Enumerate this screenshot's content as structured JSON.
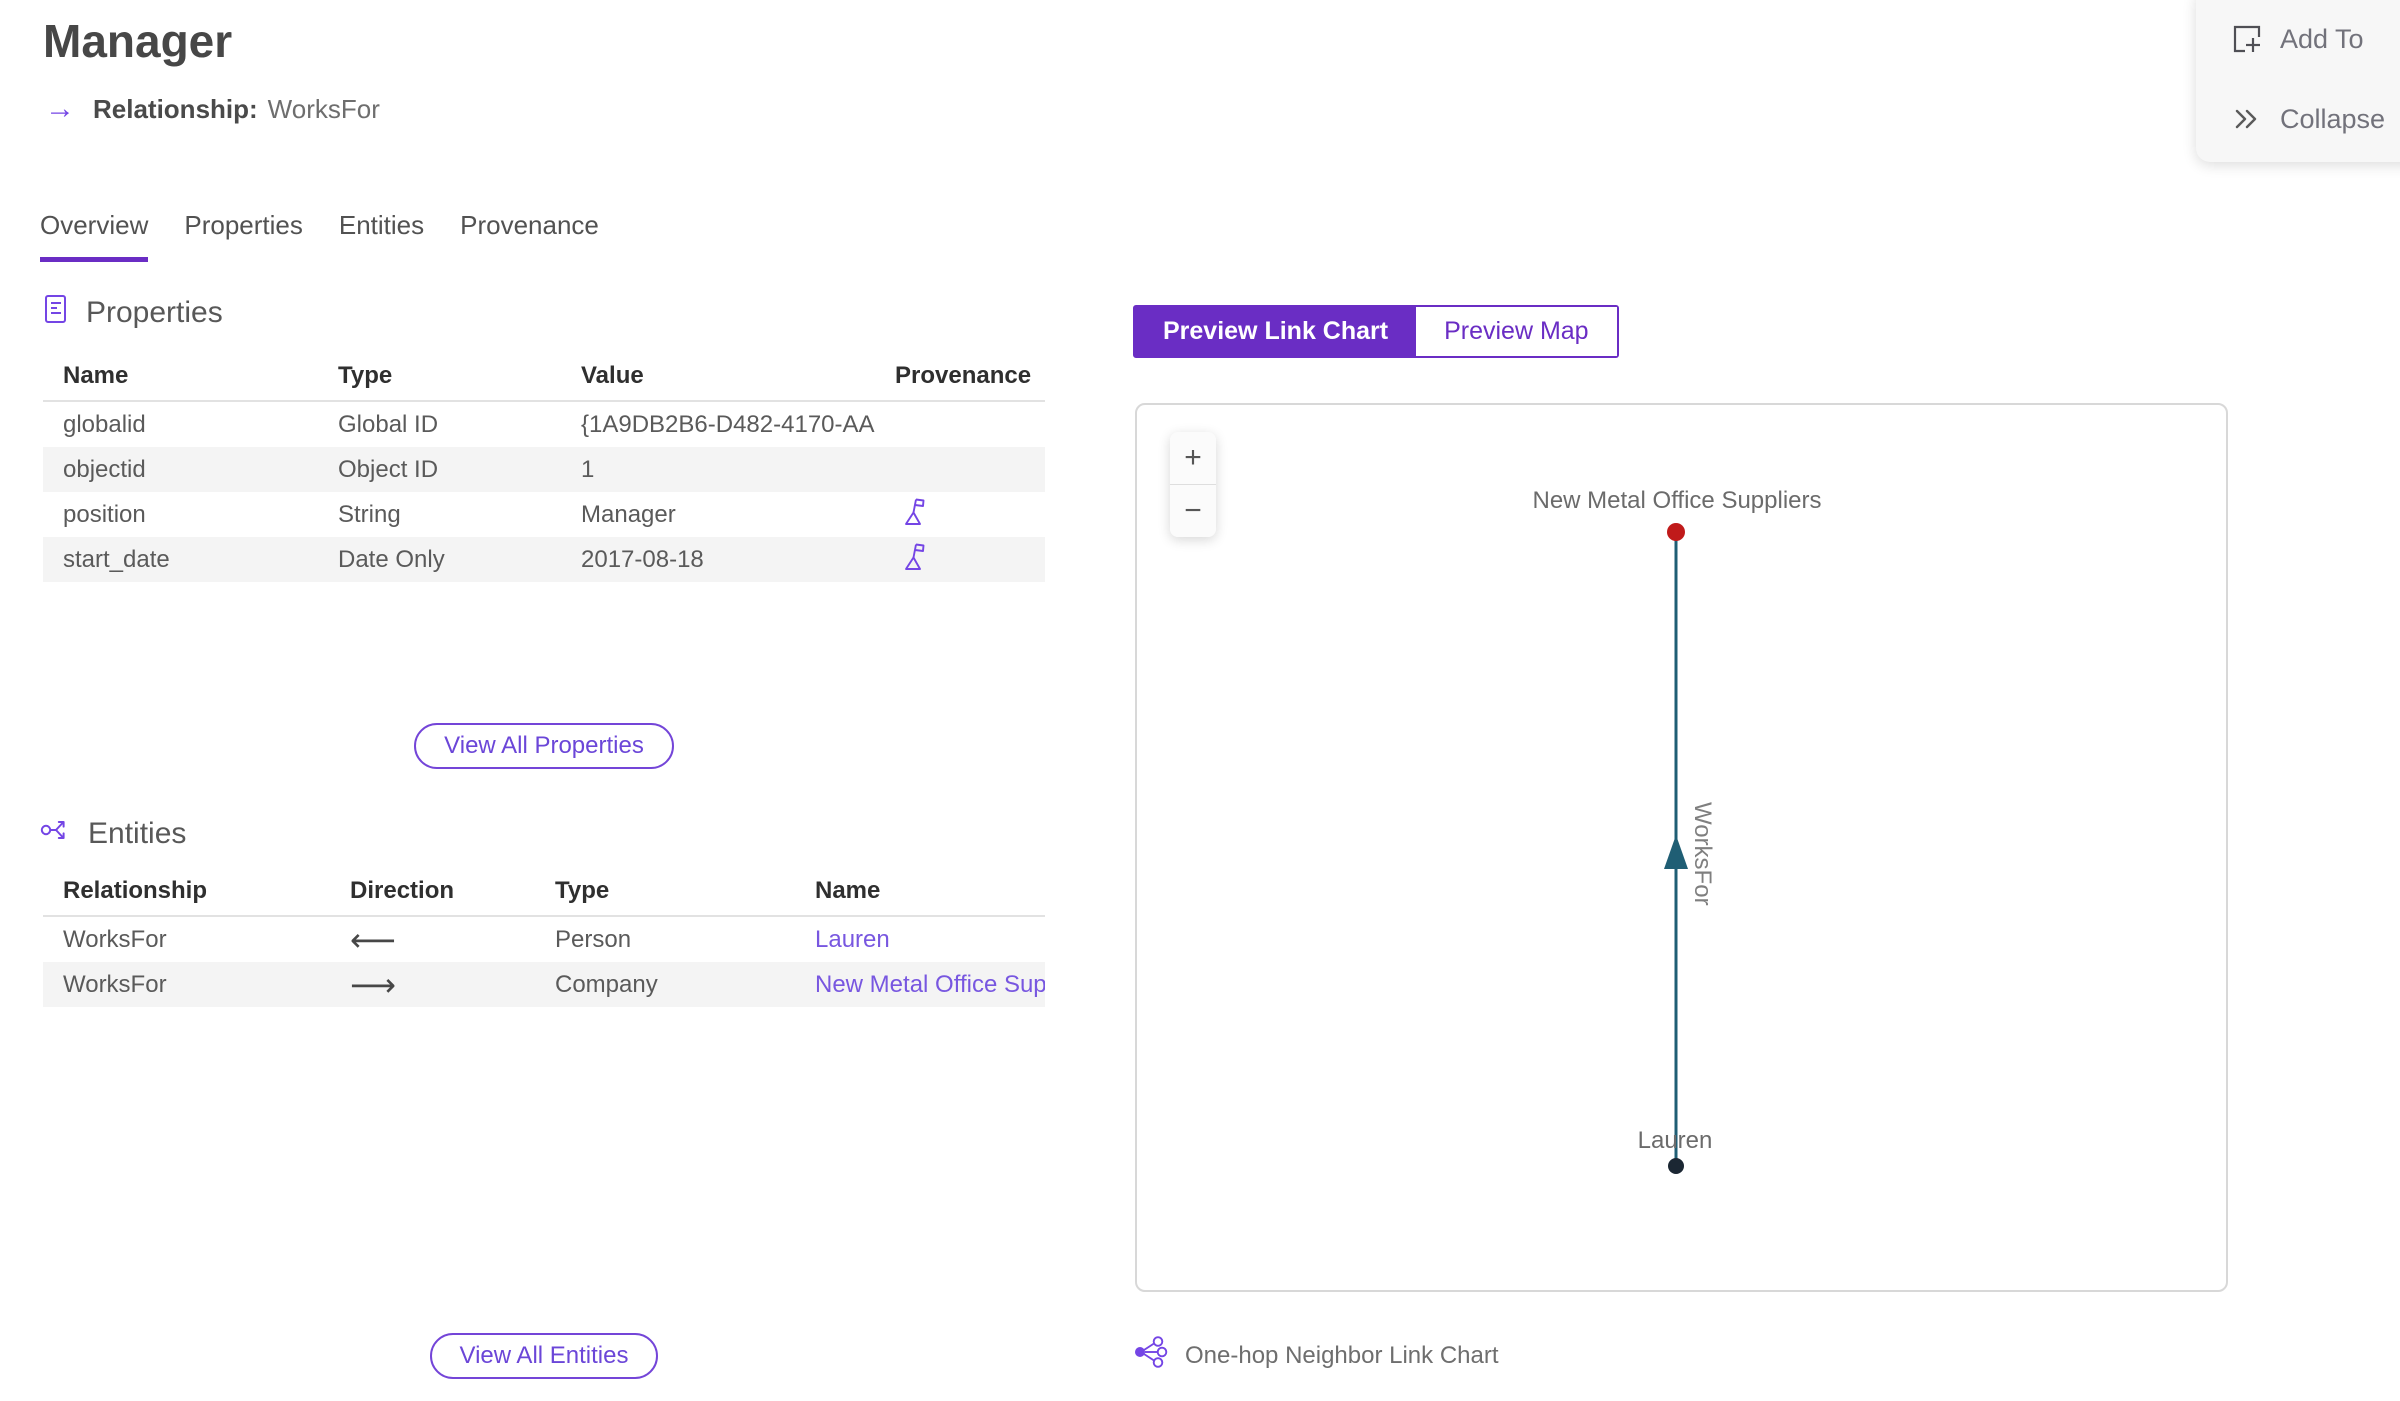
{
  "header": {
    "title": "Manager",
    "arrow": "→",
    "subtitle_label": "Relationship:",
    "subtitle_value": "WorksFor"
  },
  "actions": {
    "add_to_label": "Add To",
    "collapse_label": "Collapse"
  },
  "tabs": [
    {
      "label": "Overview"
    },
    {
      "label": "Properties"
    },
    {
      "label": "Entities"
    },
    {
      "label": "Provenance"
    }
  ],
  "properties_section": {
    "heading": "Properties",
    "columns": [
      "Name",
      "Type",
      "Value",
      "Provenance"
    ],
    "rows": [
      {
        "name": "globalid",
        "type": "Global ID",
        "value": "{1A9DB2B6-D482-4170-AA..."
      },
      {
        "name": "objectid",
        "type": "Object ID",
        "value": "1"
      },
      {
        "name": "position",
        "type": "String",
        "value": "Manager"
      },
      {
        "name": "start_date",
        "type": "Date Only",
        "value": "2017-08-18"
      }
    ],
    "view_all_label": "View All Properties"
  },
  "entities_section": {
    "heading": "Entities",
    "columns": [
      "Relationship",
      "Direction",
      "Type",
      "Name"
    ],
    "rows": [
      {
        "relationship": "WorksFor",
        "direction": "⟵",
        "type": "Person",
        "name": "Lauren"
      },
      {
        "relationship": "WorksFor",
        "direction": "⟶",
        "type": "Company",
        "name": "New Metal Office Sup..."
      }
    ],
    "view_all_label": "View All Entities"
  },
  "preview": {
    "toggle_link_chart": "Preview Link Chart",
    "toggle_map": "Preview Map",
    "zoom_in": "+",
    "zoom_out": "−",
    "caption": "One-hop Neighbor Link Chart"
  },
  "chart_data": {
    "type": "link-chart",
    "nodes": [
      {
        "label": "New Metal Office Suppliers",
        "color": "#c01a1a",
        "position": "top"
      },
      {
        "label": "Lauren",
        "color": "#1b2733",
        "position": "bottom"
      }
    ],
    "edges": [
      {
        "label": "WorksFor",
        "from": "Lauren",
        "to": "New Metal Office Suppliers",
        "color": "#1f5e74",
        "direction": "up"
      }
    ]
  },
  "colors": {
    "accent_purple": "#6a2dc4",
    "link_purple": "#7857e0",
    "icon_purple": "#7445e5",
    "edge_teal": "#1f5e74",
    "node_red": "#c01a1a",
    "node_dark": "#1b2733"
  }
}
